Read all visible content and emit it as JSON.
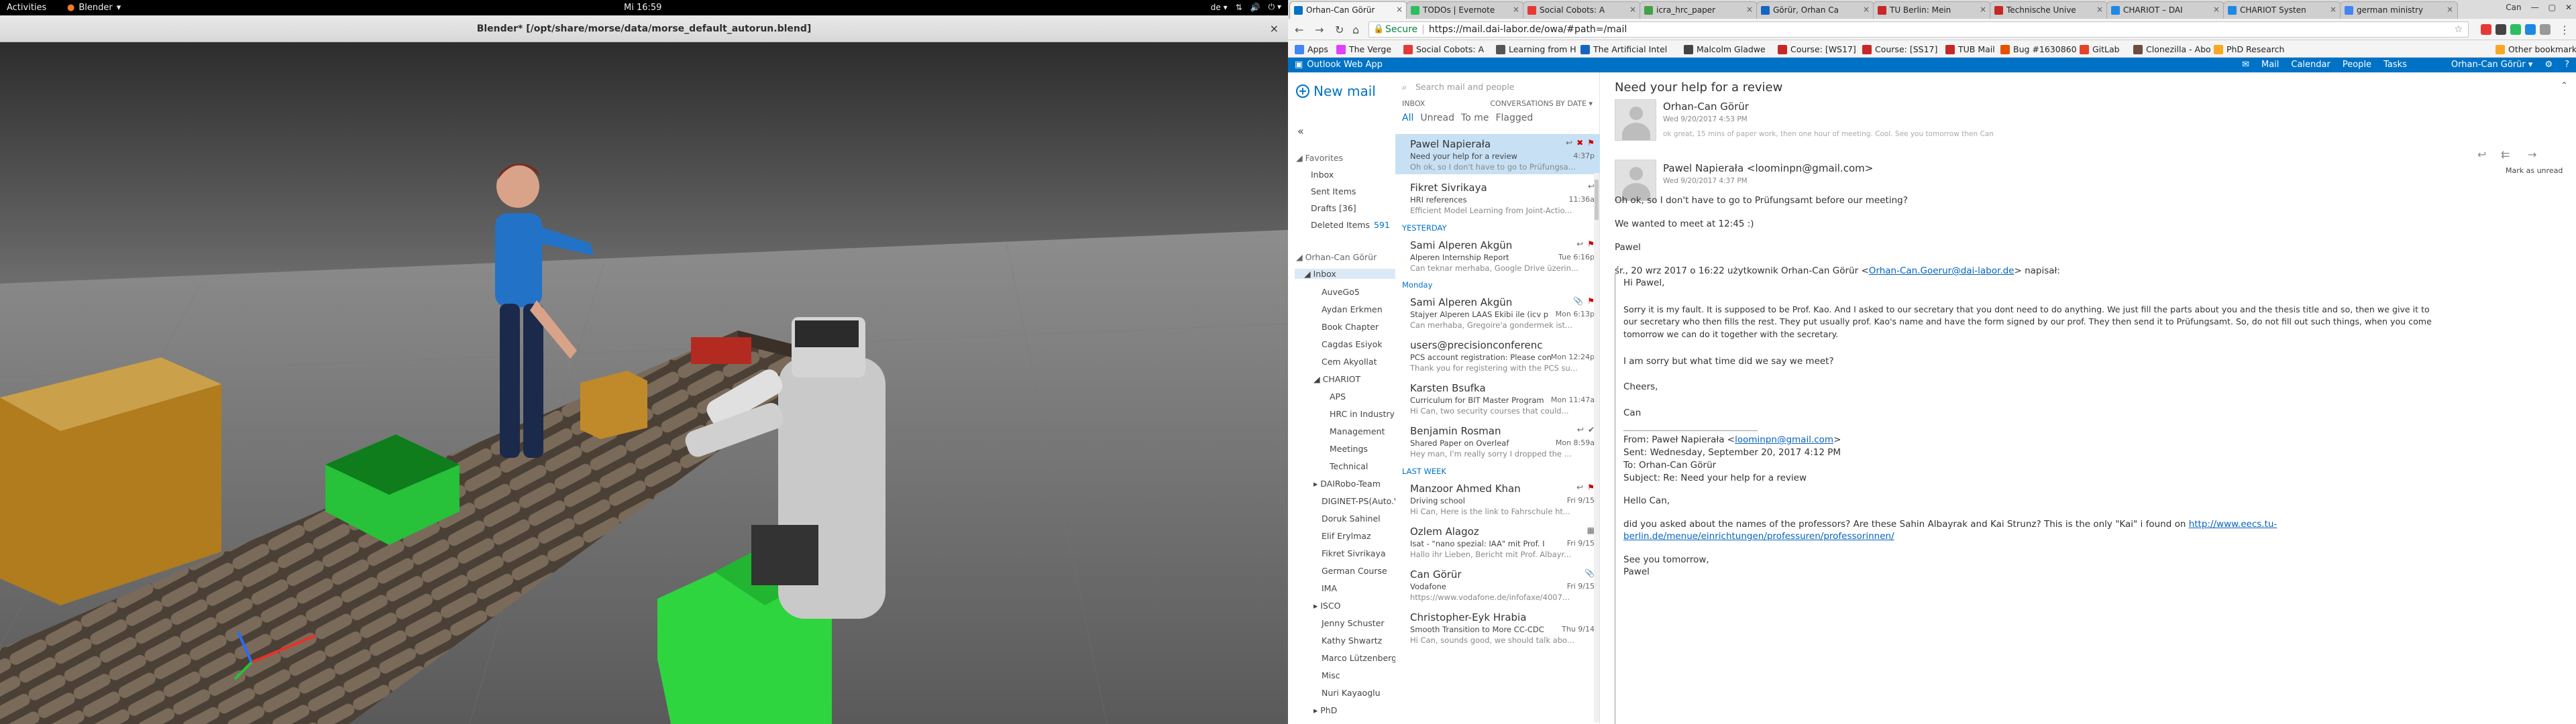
{
  "topbar": {
    "activities": "Activities",
    "app_menu": "Blender",
    "clock": "Mi 16:59",
    "keyboard_layout": "de"
  },
  "blender": {
    "window_title": "Blender* [/opt/share/morse/data/morse_default_autorun.blend]",
    "close": "×"
  },
  "chrome": {
    "tabs": [
      {
        "title": "Orhan-Can Görür",
        "color": "#0072c6",
        "active": true
      },
      {
        "title": "TODOs | Evernote",
        "color": "#2dbe60",
        "active": false
      },
      {
        "title": "Social Cobots: A",
        "color": "#e53935",
        "active": false
      },
      {
        "title": "icra_hrc_paper",
        "color": "#43a047",
        "active": false
      },
      {
        "title": "Görür, Orhan Ca",
        "color": "#1565c0",
        "active": false
      },
      {
        "title": "TU Berlin: Mein",
        "color": "#c62828",
        "active": false
      },
      {
        "title": "Technische Unive",
        "color": "#c62828",
        "active": false
      },
      {
        "title": "CHARIOT – DAI",
        "color": "#1e88e5",
        "active": false
      },
      {
        "title": "CHARIOT Systen",
        "color": "#1e88e5",
        "active": false
      },
      {
        "title": "german ministry",
        "color": "#4285f4",
        "active": false
      }
    ],
    "profile_label": "Can",
    "secure_label": "Secure",
    "url": "https://mail.dai-labor.de/owa/#path=/mail",
    "bookmarks": [
      {
        "label": "Apps",
        "color": "#4285f4"
      },
      {
        "label": "The Verge",
        "color": "#e040fb"
      },
      {
        "label": "Social Cobots: A",
        "color": "#e53935"
      },
      {
        "label": "Learning from H",
        "color": "#555555"
      },
      {
        "label": "The Artificial Intel",
        "color": "#1565c0"
      },
      {
        "label": "Malcolm Gladwe",
        "color": "#444444"
      },
      {
        "label": "Course: [WS17]",
        "color": "#c62828"
      },
      {
        "label": "Course: [SS17]",
        "color": "#c62828"
      },
      {
        "label": "TUB Mail",
        "color": "#c62828"
      },
      {
        "label": "Bug #1630860",
        "color": "#e65100"
      },
      {
        "label": "GitLab",
        "color": "#e24329"
      },
      {
        "label": "Clonezilla - Abo",
        "color": "#6d4c41"
      },
      {
        "label": "PhD Research",
        "color": "#f9a825"
      }
    ],
    "other_bookmarks": "Other bookmarks"
  },
  "owa": {
    "app_name": "Outlook Web App",
    "nav": [
      "Mail",
      "Calendar",
      "People",
      "Tasks"
    ],
    "user": "Orhan-Can Görür",
    "new_mail": "New mail",
    "favorites_label": "Favorites",
    "favorites": [
      {
        "label": "Inbox",
        "count": ""
      },
      {
        "label": "Sent Items",
        "count": ""
      },
      {
        "label": "Drafts",
        "count": "[36]"
      },
      {
        "label": "Deleted Items",
        "count": "591"
      }
    ],
    "account": "Orhan-Can Görür",
    "inbox_label": "Inbox",
    "folders": [
      "AuveGo5",
      "Aydan Erkmen",
      "Book Chapter",
      "Cagdas Esiyok",
      "Cem Akyollat",
      "CHARIOT",
      "APS",
      "HRC in Industry",
      "Management",
      "Meetings",
      "Technical",
      "DAIRobo-Team",
      "DIGINET-PS(Auto.Vehicle)",
      "Doruk Sahinel",
      "Elif Erylmaz",
      "Fikret Sivrikaya",
      "German Course",
      "IMA",
      "ISCO",
      "Jenny Schuster",
      "Kathy Shwartz",
      "Marco Lützenberger",
      "Misc",
      "Nuri Kayaoglu",
      "PhD"
    ],
    "search_placeholder": "Search mail and people",
    "list_folder": "INBOX",
    "list_sort": "CONVERSATIONS BY DATE",
    "filters": [
      "All",
      "Unread",
      "To me",
      "Flagged"
    ],
    "groups": {
      "yesterday": "YESTERDAY",
      "monday": "Monday",
      "last_week": "LAST WEEK"
    },
    "messages": [
      {
        "from": "Pawel Napierała",
        "subject": "Need your help for a review",
        "preview": "Oh ok, so I don't have to go to Prüfungsa...",
        "date": "4:37p"
      },
      {
        "from": "Fikret Sivrikaya",
        "subject": "HRI references",
        "preview": "Efficient Model Learning from Joint-Actio...",
        "date": "11:36a"
      },
      {
        "from": "Sami Alperen Akgün",
        "subject": "Alperen Internship Report",
        "preview": "Can teknar merhaba, Google Drive üzerin...",
        "date": "Tue 6:16p"
      },
      {
        "from": "Sami Alperen Akgün",
        "subject": "Stajyer Alperen LAAS Ekibi ile (icv p",
        "preview": "Can merhaba, Gregoire'a gondermek ist...",
        "date": "Mon 6:13p"
      },
      {
        "from": "users@precisionconferenc",
        "subject": "PCS account registration: Please con",
        "preview": "Thank you for registering with the PCS su...",
        "date": "Mon 12:24p"
      },
      {
        "from": "Karsten Bsufka",
        "subject": "Curriculum for BIT Master Program",
        "preview": "Hi Can, two security courses that could...",
        "date": "Mon 11:47a"
      },
      {
        "from": "Benjamin Rosman",
        "subject": "Shared Paper on Overleaf",
        "preview": "Hey man, I'm really sorry I dropped the ...",
        "date": "Mon 8:59a"
      },
      {
        "from": "Manzoor Ahmed Khan",
        "subject": "Driving school",
        "preview": "Hi Can, Here is the link to Fahrschule ht...",
        "date": "Fri 9/15"
      },
      {
        "from": "Ozlem Alagoz",
        "subject": "Isat - \"nano spezial: IAA\" mit Prof. I",
        "preview": "Hallo ihr Lieben, Bericht mit Prof. Albayr...",
        "date": "Fri 9/15"
      },
      {
        "from": "Can Görür",
        "subject": "Vodafone",
        "preview": "https://www.vodafone.de/infofaxe/4007...",
        "date": "Fri 9/15"
      },
      {
        "from": "Christopher-Eyk Hrabia",
        "subject": "Smooth Transition to More CC-CDC",
        "preview": "Hi Can, sounds good, we should talk abo...",
        "date": "Thu 9/14"
      }
    ],
    "reading": {
      "subject": "Need your help for a review",
      "msg1": {
        "sender": "Orhan-Can Görür",
        "when": "Wed 9/20/2017 4:53 PM",
        "snippet": "ok great, 15 mins of paper work, then one hour of meeting. Cool. See you tomorrow then Can"
      },
      "msg2": {
        "sender": "Pawel Napierała <loominpn@gmail.com>",
        "when": "Wed 9/20/2017 4:37 PM",
        "mark_unread": "Mark as unread",
        "lines": [
          "Oh ok, so I don't have to go to Prüfungsamt before our meeting?",
          "We wanted to meet at 12:45 :)",
          "Pawel"
        ],
        "quote_intro": "śr., 20 wrz 2017 o 16:22 użytkownik Orhan-Can Görür <",
        "quote_email": "Orhan-Can.Goerur@dai-labor.de",
        "quote_intro_end": "> napisał:",
        "hi": "Hi Pawel,",
        "para1a": "Sorry it is my fault. It is supposed to be Prof. Kao. And I asked to our secretary that you dont need to do anything. We just fill the parts about you and the thesis title and so, then we give it to",
        "para1b": "our secretary who then fills the rest. They put usually prof. Kao's name and have the form signed by our prof. They then send it to Prüfungsamt. So, do not fill out such things, when you come",
        "para1c": "tomorrow we can do it together with the secretary.",
        "para2": "I am sorry but what time did we say we meet?",
        "cheers": "Cheers,",
        "can": "Can",
        "fwd_from_label": "From: Paweł Napierała <",
        "fwd_from_email": "loominpn@gmail.com",
        "fwd_from_end": ">",
        "fwd_sent": "Sent: Wednesday, September 20, 2017 4:12 PM",
        "fwd_to": "To: Orhan-Can Görür",
        "fwd_subject": "Subject: Re: Need your help for a review",
        "hello": "Hello Can,",
        "ask": "did you asked about the names of the professors? Are these Sahin Albayrak and Kai Strunz? This is the only \"Kai\" i found on",
        "ask_link1": "http://www.eecs.tu-",
        "ask_link2": "berlin.de/menue/einrichtungen/professuren/professorinnen/",
        "see": "See you tomorrow,",
        "sign": "Pawel"
      }
    }
  }
}
